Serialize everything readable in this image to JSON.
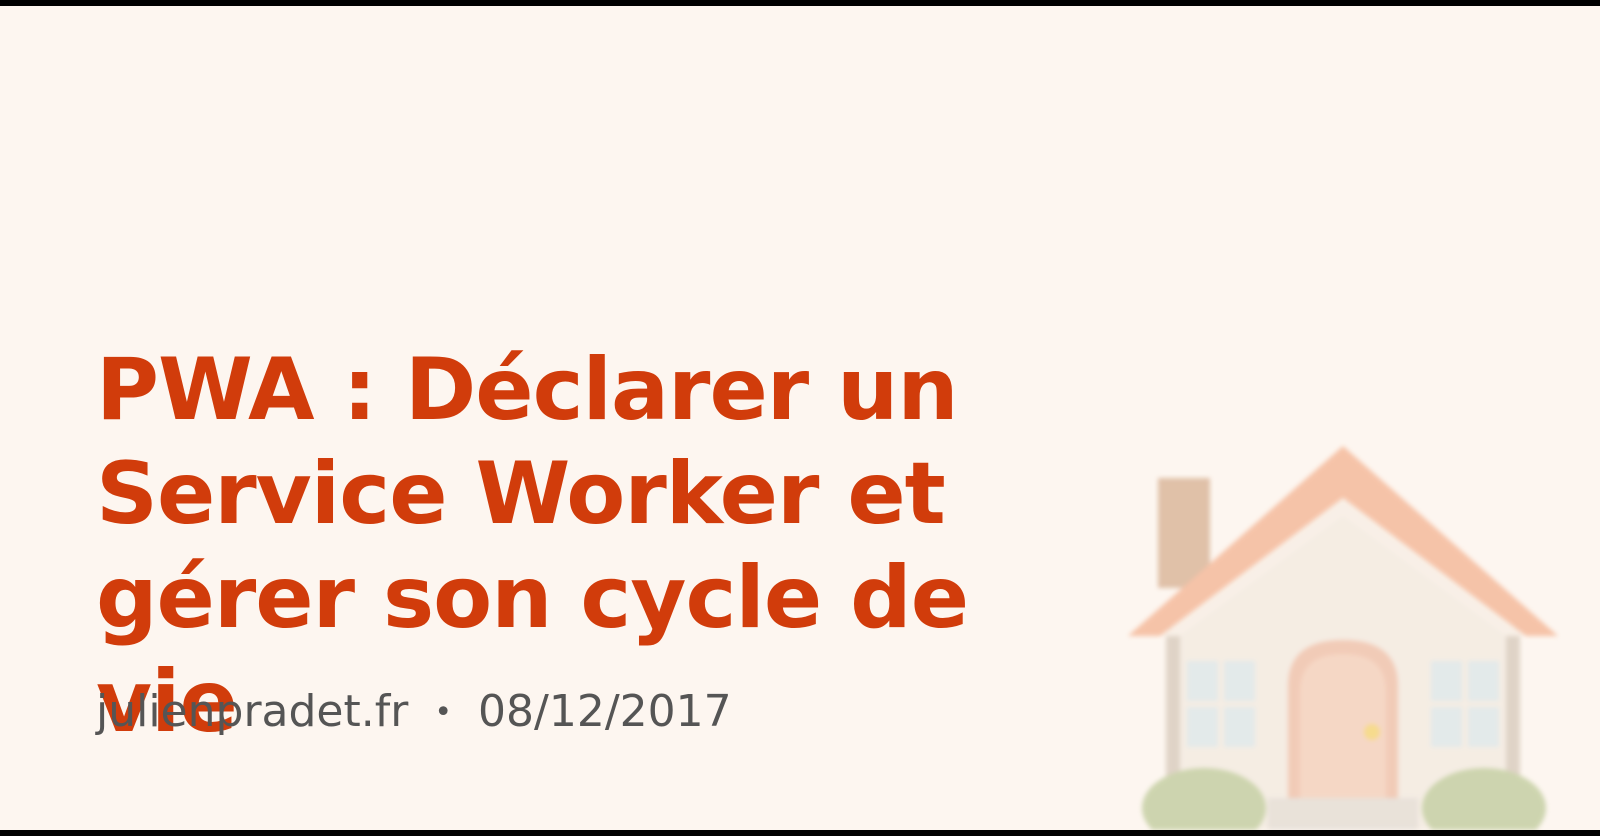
{
  "article": {
    "title": "PWA : Déclarer un Service Worker et gérer son cycle de vie",
    "site": "julienpradet.fr",
    "separator": "•",
    "date": "08/12/2017"
  },
  "colors": {
    "background": "#fdf6f0",
    "title": "#d13c0b",
    "meta": "#555555"
  },
  "illustration": {
    "icon": "house-icon"
  }
}
